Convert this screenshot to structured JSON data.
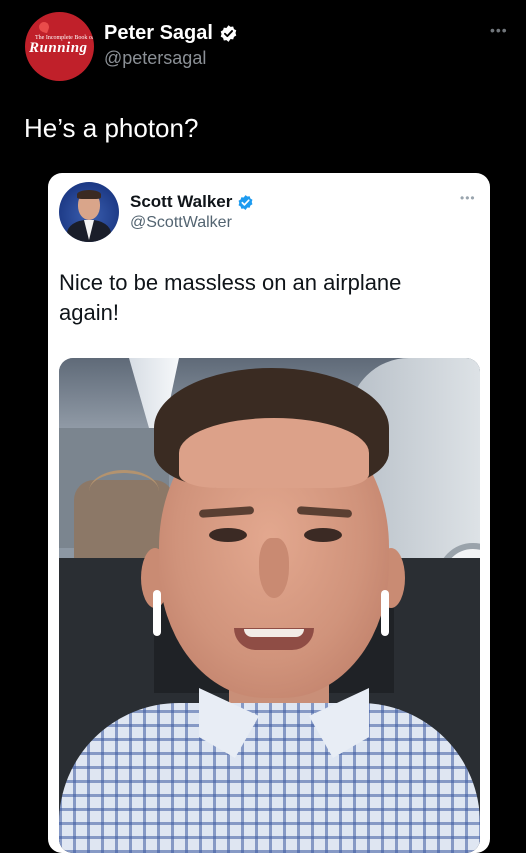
{
  "outer_tweet": {
    "author": {
      "name": "Peter Sagal",
      "handle": "@petersagal",
      "verified": true,
      "avatar": {
        "small_text": "The Incomplete Book of",
        "big_text": "Running",
        "color": "#c0202a"
      }
    },
    "more_icon": "more-horizontal-icon",
    "text": "He’s a photon?"
  },
  "quoted_tweet": {
    "author": {
      "name": "Scott Walker",
      "handle": "@ScottWalker",
      "verified": true,
      "verified_color": "#1d9bf0"
    },
    "more_icon": "more-horizontal-icon",
    "text": "Nice to be massless on an airplane again!",
    "media": "selfie-photo"
  },
  "colors": {
    "background": "#000000",
    "card_background": "#ffffff",
    "secondary_text_dark": "#8b9096",
    "secondary_text_light": "#536471"
  }
}
